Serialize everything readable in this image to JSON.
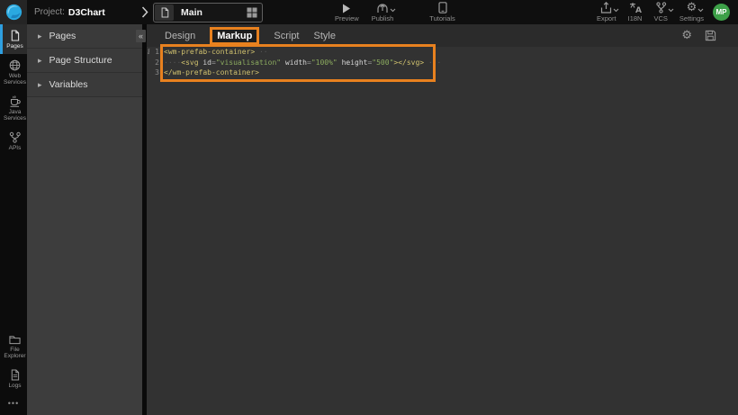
{
  "colors": {
    "accent_orange": "#E8811F",
    "accent_blue": "#2E9FE0",
    "avatar_green": "#3DA048",
    "logo_blue": "#2AA9E0"
  },
  "topbar": {
    "project_label": "Project:",
    "project_name": "D3Chart",
    "page_tab": {
      "label": "Main"
    },
    "actions_center": {
      "preview": "Preview",
      "publish": "Publish",
      "tutorials": "Tutorials"
    },
    "actions_right": {
      "export": "Export",
      "i18n": "I18N",
      "vcs": "VCS",
      "settings": "Settings",
      "avatar_initials": "MP"
    }
  },
  "rail": {
    "items": [
      {
        "label": "Pages",
        "icon": "page-icon",
        "active": true
      },
      {
        "label": "Web Services",
        "icon": "globe-icon",
        "active": false
      },
      {
        "label": "Java Services",
        "icon": "coffee-icon",
        "active": false
      },
      {
        "label": "APIs",
        "icon": "api-icon",
        "active": false
      },
      {
        "label": "File Explorer",
        "icon": "folder-icon",
        "active": false
      },
      {
        "label": "Logs",
        "icon": "log-file-icon",
        "active": false
      }
    ],
    "more_glyph": "•••"
  },
  "panel": {
    "items": [
      {
        "label": "Pages"
      },
      {
        "label": "Page Structure"
      },
      {
        "label": "Variables"
      }
    ],
    "collapse_glyph": "«"
  },
  "editor": {
    "tabs": [
      {
        "label": "Design",
        "active": false
      },
      {
        "label": "Markup",
        "active": true
      },
      {
        "label": "Script",
        "active": false
      },
      {
        "label": "Style",
        "active": false
      }
    ],
    "gutter_marker": "i",
    "lines": [
      {
        "num": "1",
        "tokens": [
          {
            "c": "tag",
            "t": "<wm-prefab-container>"
          },
          {
            "c": "ws",
            "t": " ··"
          }
        ]
      },
      {
        "num": "2",
        "tokens": [
          {
            "c": "ws",
            "t": "····"
          },
          {
            "c": "tag",
            "t": "<svg"
          },
          {
            "c": "pl",
            "t": " "
          },
          {
            "c": "attr",
            "t": "id"
          },
          {
            "c": "op",
            "t": "="
          },
          {
            "c": "str",
            "t": "\"visualisation\""
          },
          {
            "c": "pl",
            "t": " "
          },
          {
            "c": "attr",
            "t": "width"
          },
          {
            "c": "op",
            "t": "="
          },
          {
            "c": "str",
            "t": "\"100%\""
          },
          {
            "c": "pl",
            "t": " "
          },
          {
            "c": "attr",
            "t": "height"
          },
          {
            "c": "op",
            "t": "="
          },
          {
            "c": "str",
            "t": "\"500\""
          },
          {
            "c": "tag",
            "t": "></svg>"
          },
          {
            "c": "ws",
            "t": " ···"
          }
        ]
      },
      {
        "num": "3",
        "tokens": [
          {
            "c": "tag",
            "t": "</wm-prefab-container>"
          }
        ]
      }
    ]
  }
}
